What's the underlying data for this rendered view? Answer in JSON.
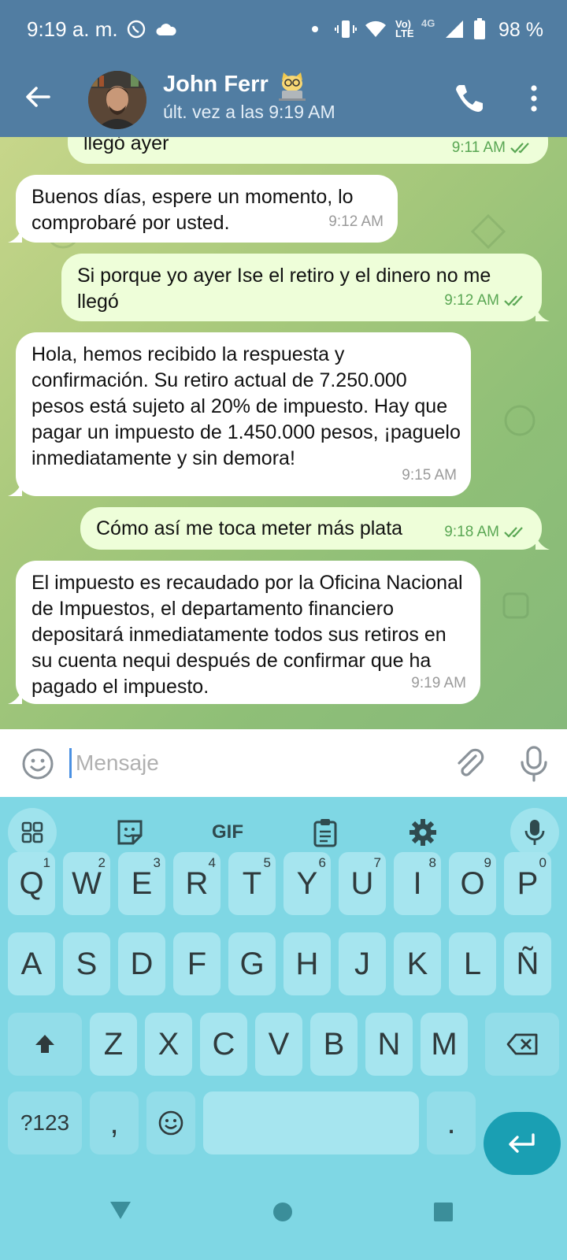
{
  "status": {
    "time": "9:19 a. m.",
    "battery": "98 %",
    "volte_label": "Vo) LTE",
    "network": "4G"
  },
  "header": {
    "contact_name": "John Ferr",
    "last_seen": "últ. vez a las 9:19 AM"
  },
  "messages": [
    {
      "dir": "out",
      "text": "llegó ayer",
      "time": "9:11 AM",
      "read": true
    },
    {
      "dir": "in",
      "text": "Buenos días, espere un momento, lo comprobaré por usted.",
      "time": "9:12 AM"
    },
    {
      "dir": "out",
      "text": "Si porque yo ayer Ise el retiro y el dinero no me llegó",
      "time": "9:12 AM",
      "read": true
    },
    {
      "dir": "in",
      "text": "Hola, hemos recibido la respuesta y confirmación. Su retiro actual de 7.250.000 pesos está sujeto al 20% de impuesto. Hay que pagar un impuesto de 1.450.000 pesos, ¡paguelo inmediatamente y sin demora!",
      "time": "9:15 AM"
    },
    {
      "dir": "out",
      "text": "Cómo así me toca meter más plata",
      "time": "9:18 AM",
      "read": true
    },
    {
      "dir": "in",
      "text": "El impuesto es recaudado por la Oficina Nacional de Impuestos, el departamento financiero depositará inmediatamente todos sus retiros en su cuenta nequi después de confirmar que ha pagado el impuesto.",
      "time": "9:19 AM"
    }
  ],
  "composer": {
    "placeholder": "Mensaje"
  },
  "keyboard": {
    "toolbar": {
      "gif_label": "GIF"
    },
    "row1": [
      {
        "k": "Q",
        "h": "1"
      },
      {
        "k": "W",
        "h": "2"
      },
      {
        "k": "E",
        "h": "3"
      },
      {
        "k": "R",
        "h": "4"
      },
      {
        "k": "T",
        "h": "5"
      },
      {
        "k": "Y",
        "h": "6"
      },
      {
        "k": "U",
        "h": "7"
      },
      {
        "k": "I",
        "h": "8"
      },
      {
        "k": "O",
        "h": "9"
      },
      {
        "k": "P",
        "h": "0"
      }
    ],
    "row2": [
      "A",
      "S",
      "D",
      "F",
      "G",
      "H",
      "J",
      "K",
      "L",
      "Ñ"
    ],
    "row3": [
      "Z",
      "X",
      "C",
      "V",
      "B",
      "N",
      "M"
    ],
    "symbols_label": "?123",
    "comma_label": ",",
    "period_label": "."
  },
  "colors": {
    "header": "#517da2",
    "incoming_bubble": "#ffffff",
    "outgoing_bubble": "#eefed9",
    "keyboard": "#7fd7e4",
    "enter_key": "#1a9fb3"
  }
}
